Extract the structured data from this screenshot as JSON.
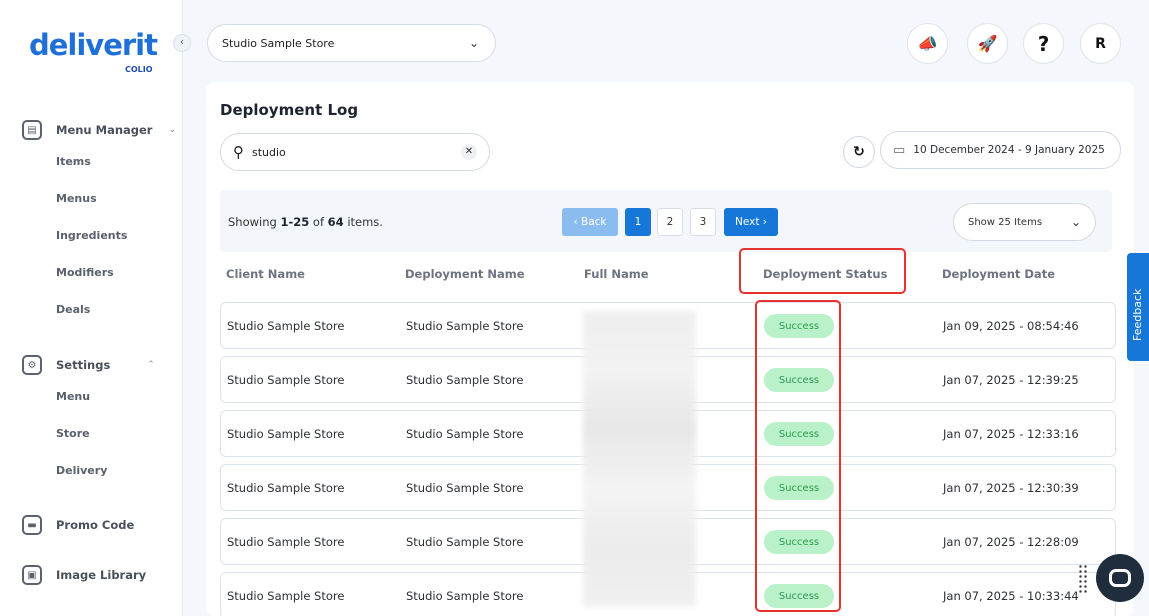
{
  "brand": {
    "name": "deliverit",
    "sub": "COLIO"
  },
  "sidebar": {
    "collapse_glyph": "‹",
    "groups": [
      {
        "label": "Menu Manager",
        "icon": "menu-book-icon",
        "items": [
          "Items",
          "Menus",
          "Ingredients",
          "Modifiers",
          "Deals"
        ]
      },
      {
        "label": "Settings",
        "icon": "gear-icon",
        "items": [
          "Menu",
          "Store",
          "Delivery"
        ]
      },
      {
        "label": "Promo Code",
        "icon": "ticket-icon",
        "items": []
      },
      {
        "label": "Image Library",
        "icon": "image-icon",
        "items": []
      }
    ]
  },
  "topbar": {
    "store_select": "Studio Sample Store",
    "help": "?",
    "avatar": "R"
  },
  "page": {
    "title": "Deployment Log",
    "search_value": "studio",
    "date_range": "10 December 2024 - 9 January 2025"
  },
  "pagination": {
    "showing_prefix": "Showing ",
    "range": "1-25",
    "of_text": " of ",
    "total": "64",
    "suffix": " items.",
    "back": "‹ Back",
    "pages": [
      "1",
      "2",
      "3"
    ],
    "next": "Next ›",
    "page_size": "Show 25 Items"
  },
  "table": {
    "headers": [
      "Client Name",
      "Deployment Name",
      "Full Name",
      "Deployment Status",
      "Deployment Date"
    ],
    "rows": [
      {
        "client": "Studio Sample Store",
        "deployment": "Studio Sample Store",
        "status": "Success",
        "date": "Jan 09, 2025 - 08:54:46"
      },
      {
        "client": "Studio Sample Store",
        "deployment": "Studio Sample Store",
        "status": "Success",
        "date": "Jan 07, 2025 - 12:39:25"
      },
      {
        "client": "Studio Sample Store",
        "deployment": "Studio Sample Store",
        "status": "Success",
        "date": "Jan 07, 2025 - 12:33:16"
      },
      {
        "client": "Studio Sample Store",
        "deployment": "Studio Sample Store",
        "status": "Success",
        "date": "Jan 07, 2025 - 12:30:39"
      },
      {
        "client": "Studio Sample Store",
        "deployment": "Studio Sample Store",
        "status": "Success",
        "date": "Jan 07, 2025 - 12:28:09"
      },
      {
        "client": "Studio Sample Store",
        "deployment": "Studio Sample Store",
        "status": "Success",
        "date": "Jan 07, 2025 - 10:33:44"
      }
    ]
  },
  "feedback_tab": "Feedback",
  "colors": {
    "primary": "#1677d9",
    "success_bg": "#b9f2c8",
    "success_text": "#2c9950",
    "highlight": "#e3342f"
  }
}
